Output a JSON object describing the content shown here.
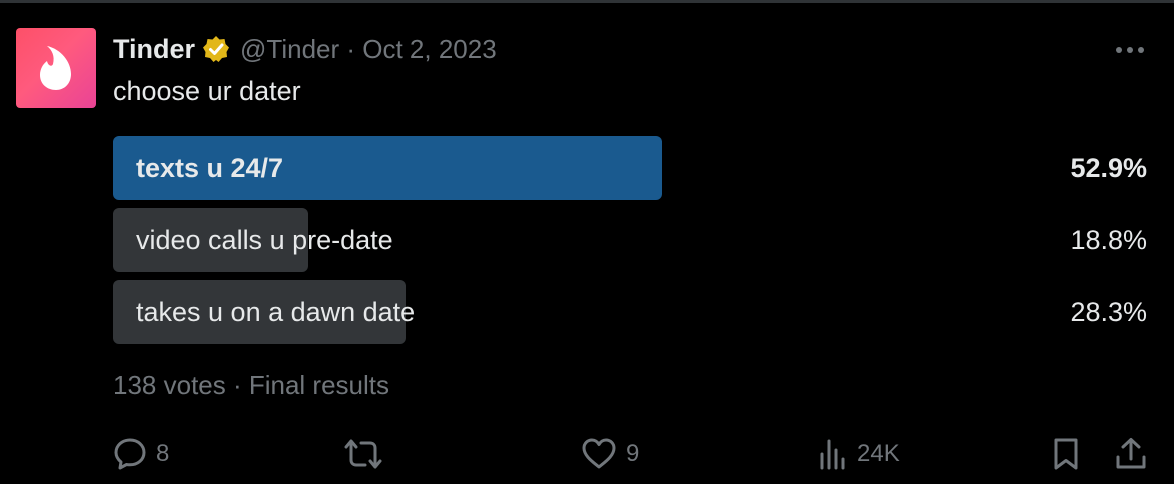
{
  "tweet": {
    "author_name": "Tinder",
    "meta": "@Tinder · Oct 2, 2023",
    "text": "choose ur dater"
  },
  "poll": {
    "options": [
      {
        "label": "texts u 24/7",
        "percent": "52.9%",
        "fraction": 0.529,
        "winner": true
      },
      {
        "label": "video calls u pre-date",
        "percent": "18.8%",
        "fraction": 0.188,
        "winner": false
      },
      {
        "label": "takes u on a dawn date",
        "percent": "28.3%",
        "fraction": 0.283,
        "winner": false
      }
    ],
    "summary": "138 votes · Final results"
  },
  "actions": {
    "replies": "8",
    "likes": "9",
    "views": "24K"
  },
  "colors": {
    "background": "#000000",
    "text": "#e7e9ea",
    "muted": "#71767b",
    "winner_bar": "#1a5a8f",
    "other_bar": "#333639",
    "verified_badge": "#e2b719",
    "avatar_brand": "#fd5068"
  },
  "icons": [
    "tinder-flame-icon",
    "verified-badge-icon",
    "more-icon",
    "reply-icon",
    "retweet-icon",
    "like-icon",
    "views-icon",
    "bookmark-icon",
    "share-icon"
  ]
}
